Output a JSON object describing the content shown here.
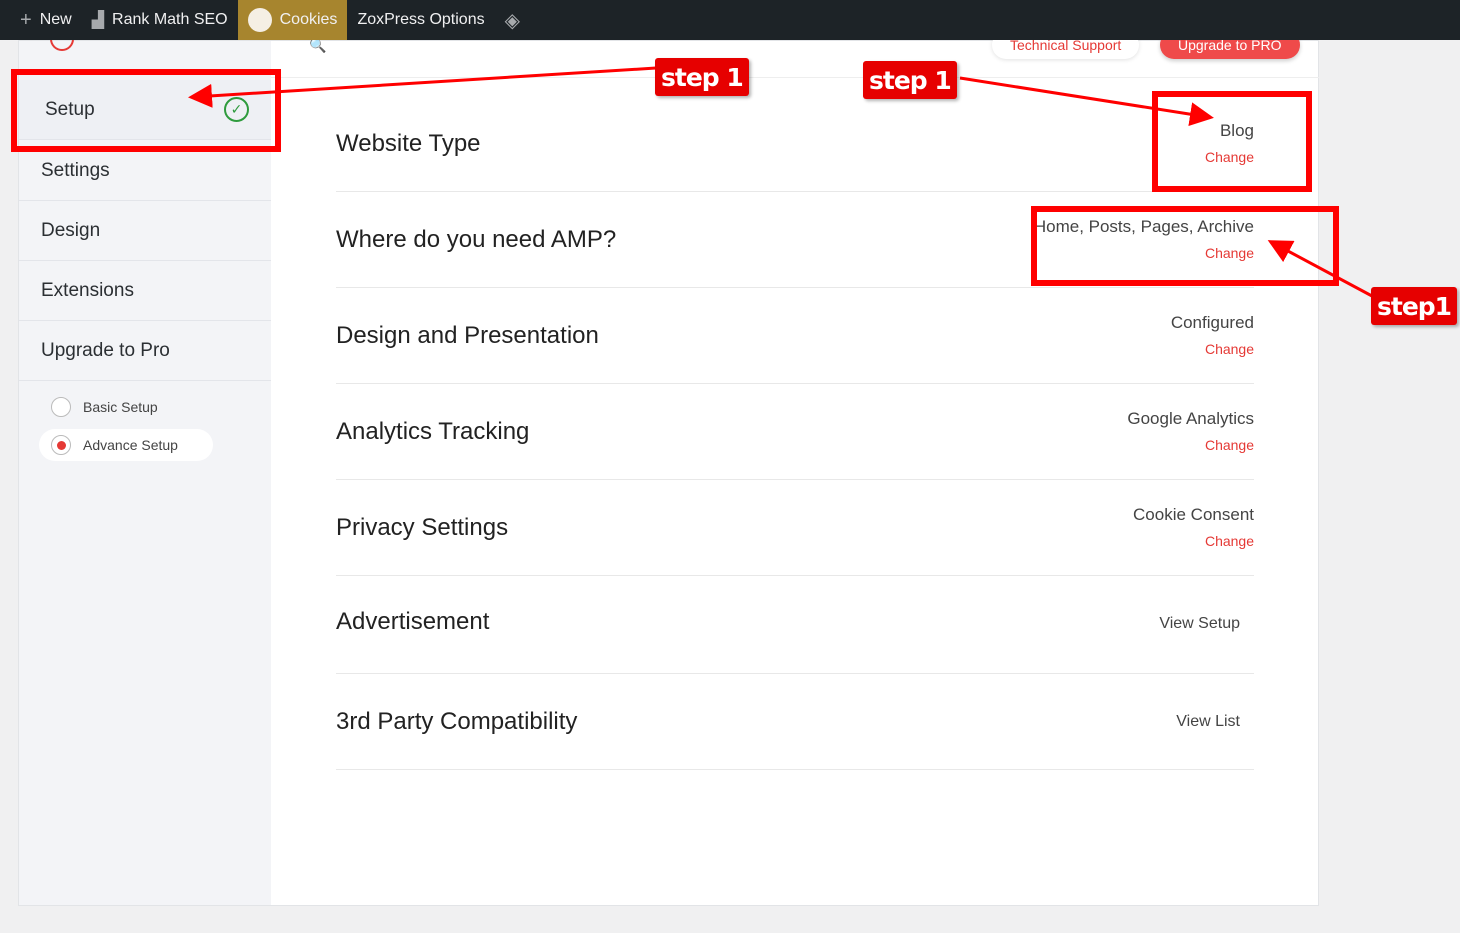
{
  "admin_bar": {
    "items": [
      {
        "icon": "plus-icon",
        "label": "New"
      },
      {
        "icon": "rank-math-icon",
        "label": "Rank Math SEO"
      },
      {
        "icon": "cookie-icon",
        "label": "Cookies",
        "active": true
      },
      {
        "label": "ZoxPress Options"
      }
    ],
    "trailing_icon": "diamond-icon"
  },
  "header": {
    "support_label": "Technical Support",
    "upgrade_label": "Upgrade to PRO"
  },
  "sidebar": {
    "items": [
      {
        "label": "Setup",
        "complete": true
      },
      {
        "label": "Settings"
      },
      {
        "label": "Design"
      },
      {
        "label": "Extensions"
      },
      {
        "label": "Upgrade to Pro"
      }
    ],
    "setup_modes": [
      {
        "label": "Basic Setup",
        "selected": false
      },
      {
        "label": "Advance Setup",
        "selected": true
      }
    ]
  },
  "rows": [
    {
      "title": "Website Type",
      "value": "Blog",
      "action": "Change"
    },
    {
      "title": "Where do you need AMP?",
      "value": "Home, Posts, Pages, Archive",
      "action": "Change"
    },
    {
      "title": "Design and Presentation",
      "value": "Configured",
      "action": "Change"
    },
    {
      "title": "Analytics Tracking",
      "value": "Google Analytics",
      "action": "Change"
    },
    {
      "title": "Privacy Settings",
      "value": "Cookie Consent",
      "action": "Change"
    },
    {
      "title": "Advertisement",
      "link": "View Setup"
    },
    {
      "title": "3rd Party Compatibility",
      "link": "View List"
    }
  ],
  "annotations": {
    "tags": [
      "step 1",
      "step 1",
      "step1"
    ],
    "color": "#ff0000"
  },
  "colors": {
    "accent": "#e53935",
    "admin_bar": "#1d2327",
    "active_menu": "#a7852e",
    "success": "#2e9b3d"
  }
}
